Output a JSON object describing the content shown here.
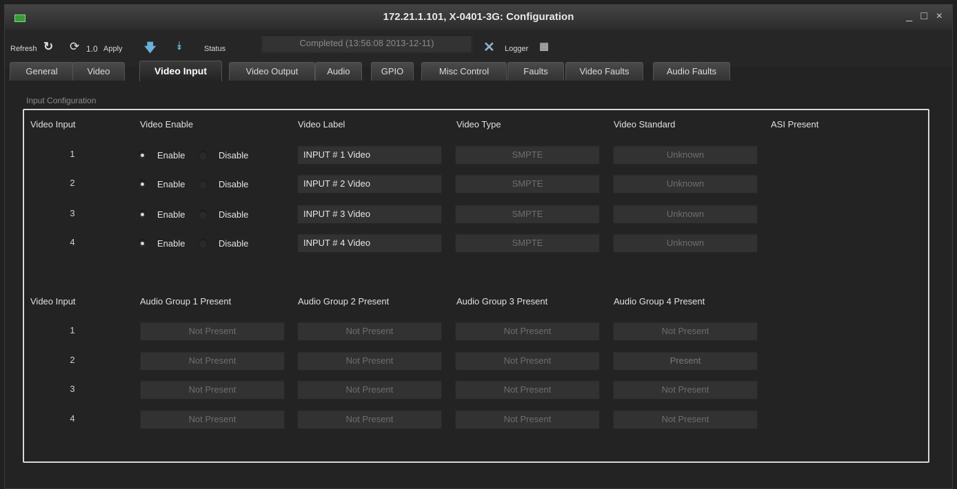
{
  "window": {
    "title": "172.21.1.101, X-0401-3G: Configuration",
    "controls": "_ □ ×"
  },
  "toolbar": {
    "refresh_label": "Refresh",
    "version_label": "1.0",
    "apply_label": "Apply",
    "status_label": "Status",
    "status_value": "Completed  (13:56:08  2013-12-11)",
    "logger_label": "Logger"
  },
  "tabs": [
    "General",
    "Video",
    "Video Input",
    "Video Output",
    "Audio",
    "GPIO",
    "Misc Control",
    "Faults",
    "Video Faults",
    "Audio Faults"
  ],
  "section_label": "Input Configuration",
  "video_table": {
    "headers": [
      "Video Input",
      "Video Enable",
      "Video Label",
      "Video Type",
      "Video Standard",
      "ASI Present"
    ],
    "enable_label": "Enable",
    "disable_label": "Disable",
    "rows": [
      {
        "input": "1",
        "enabled": true,
        "label": "INPUT # 1 Video",
        "type": "SMPTE",
        "standard": "Unknown"
      },
      {
        "input": "2",
        "enabled": true,
        "label": "INPUT # 2 Video",
        "type": "SMPTE",
        "standard": "Unknown"
      },
      {
        "input": "3",
        "enabled": true,
        "label": "INPUT # 3 Video",
        "type": "SMPTE",
        "standard": "Unknown"
      },
      {
        "input": "4",
        "enabled": true,
        "label": "INPUT # 4 Video",
        "type": "SMPTE",
        "standard": "Unknown"
      }
    ]
  },
  "audio_table": {
    "headers": [
      "Video Input",
      "Audio Group 1 Present",
      "Audio Group 2 Present",
      "Audio Group 3 Present",
      "Audio Group 4 Present"
    ],
    "rows": [
      {
        "input": "1",
        "groups": [
          "Not Present",
          "Not Present",
          "Not Present",
          "Not Present"
        ]
      },
      {
        "input": "2",
        "groups": [
          "Not Present",
          "Not Present",
          "Not Present",
          "Present"
        ]
      },
      {
        "input": "3",
        "groups": [
          "Not Present",
          "Not Present",
          "Not Present",
          "Not Present"
        ]
      },
      {
        "input": "4",
        "groups": [
          "Not Present",
          "Not Present",
          "Not Present",
          "Not Present"
        ]
      }
    ]
  }
}
